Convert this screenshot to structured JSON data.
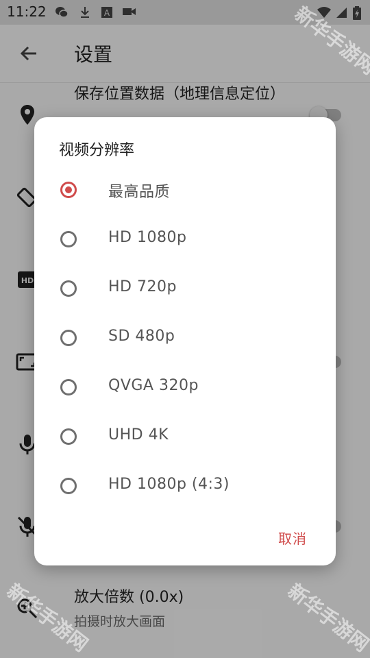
{
  "status_bar": {
    "time": "11:22",
    "icons": [
      "wechat-icon",
      "download-icon",
      "a-icon",
      "video-icon",
      "wifi-icon",
      "signal-icon",
      "battery-icon"
    ]
  },
  "app_bar": {
    "title": "设置",
    "back_icon": "arrow-back-icon"
  },
  "settings": [
    {
      "title": "保存位置数据（地理信息定位）",
      "icon": "location-icon"
    },
    {
      "title": "",
      "icon": "screen-rotation-icon"
    },
    {
      "title": "",
      "icon": "hd-icon"
    },
    {
      "title": "",
      "icon": "aspect-ratio-icon"
    },
    {
      "title": "",
      "icon": "mic-icon"
    },
    {
      "title": "",
      "icon": "mic-off-icon"
    },
    {
      "title": "放大倍数 (0.0x)",
      "subtitle": "拍摄时放大画面",
      "icon": "zoom-in-icon"
    }
  ],
  "dialog": {
    "title": "视频分辨率",
    "selected_index": 0,
    "options": [
      "最高品质",
      "HD 1080p",
      "HD 720p",
      "SD 480p",
      "QVGA 320p",
      "UHD 4K",
      "HD 1080p (4:3)"
    ],
    "cancel_label": "取消"
  },
  "watermark": "新华手游网",
  "colors": {
    "accent": "#d04b4b",
    "scrim": "rgba(0,0,0,0.32)"
  }
}
